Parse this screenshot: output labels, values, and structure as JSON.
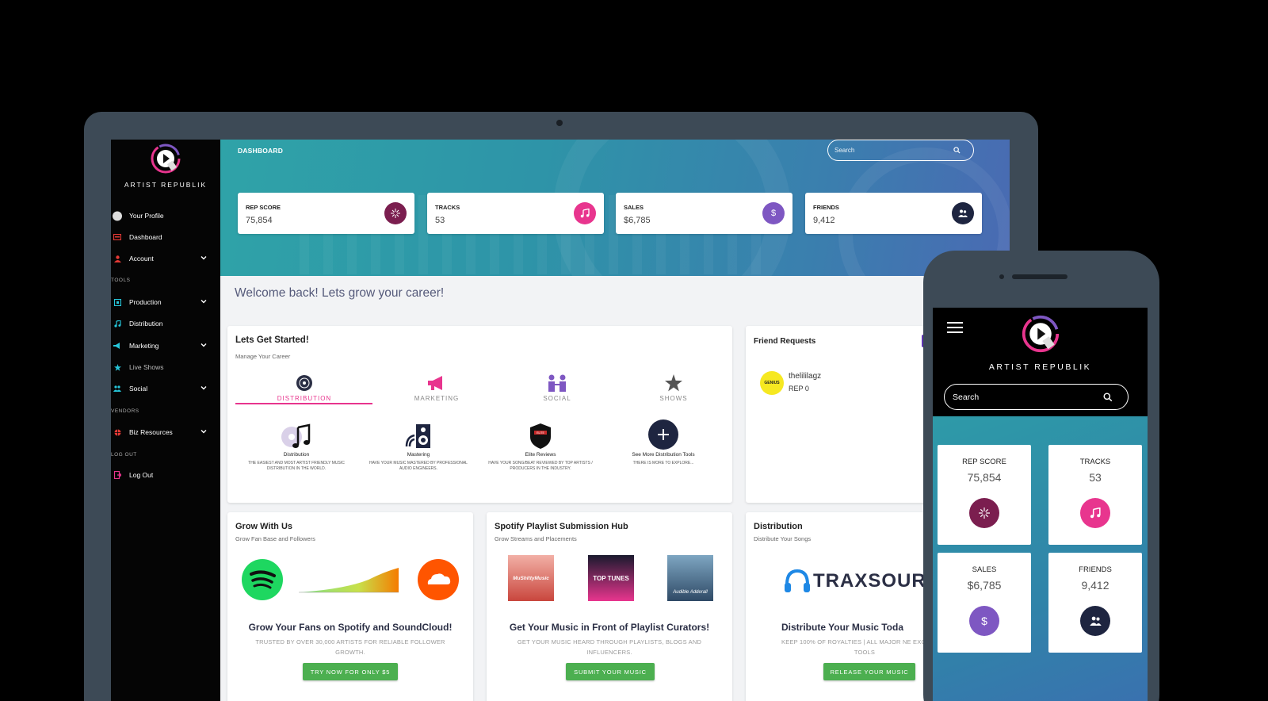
{
  "brand": {
    "name": "ARTIST REPUBLIK"
  },
  "sidebar": {
    "items": [
      {
        "label": "Your Profile",
        "icon": "avatar"
      },
      {
        "label": "Dashboard",
        "icon": "dashboard-icon"
      },
      {
        "label": "Account",
        "icon": "account-icon"
      },
      {
        "label": "Production",
        "icon": "production-icon"
      },
      {
        "label": "Distribution",
        "icon": "music-note-icon"
      },
      {
        "label": "Marketing",
        "icon": "megaphone-icon"
      },
      {
        "label": "Live Shows",
        "icon": "star-icon"
      },
      {
        "label": "Social",
        "icon": "people-icon"
      },
      {
        "label": "Biz Resources",
        "icon": "globe-icon"
      },
      {
        "label": "Log Out",
        "icon": "logout-icon"
      }
    ],
    "sections": {
      "tools": "TOOLS",
      "vendors": "VENDORS",
      "logout": "LOG OUT"
    }
  },
  "header": {
    "title": "DASHBOARD",
    "search_placeholder": "Search"
  },
  "stats": [
    {
      "label": "REP SCORE",
      "value": "75,854",
      "color": "#7b1e4f"
    },
    {
      "label": "TRACKS",
      "value": "53",
      "color": "#e8358e"
    },
    {
      "label": "SALES",
      "value": "$6,785",
      "color": "#7e57c2"
    },
    {
      "label": "FRIENDS",
      "value": "9,412",
      "color": "#1e2540"
    }
  ],
  "welcome": "Welcome back! Lets grow your career!",
  "started": {
    "title": "Lets Get Started!",
    "subtitle": "Manage Your Career",
    "tabs": [
      "DISTRIBUTION",
      "MARKETING",
      "SOCIAL",
      "SHOWS"
    ],
    "tools": [
      {
        "name": "Distribution",
        "desc": "THE EASIEST AND MOST ARTIST FRIENDLY MUSIC DISTRIBUTION IN THE WORLD."
      },
      {
        "name": "Mastering",
        "desc": "HAVE YOUR MUSIC MASTERED BY PROFESSIONAL AUDIO ENGINEERS."
      },
      {
        "name": "Elite Reviews",
        "desc": "HAVE YOUR SONG/BEAT REVIEWED BY TOP ARTISTS / PRODUCERS IN THE INDUSTRY."
      },
      {
        "name": "See More Distribution Tools",
        "desc": "THERE IS MORE TO EXPLORE..."
      }
    ]
  },
  "friend_requests": {
    "title": "Friend Requests",
    "items": [
      {
        "name": "thelililagz",
        "rep": "REP 0",
        "avatar_text": "GENIUS"
      }
    ]
  },
  "grow": {
    "title": "Grow With Us",
    "subtitle": "Grow Fan Base and Followers",
    "headline": "Grow Your Fans on Spotify and SoundCloud!",
    "text": "TRUSTED BY OVER 30,000 ARTISTS FOR RELIABLE FOLLOWER GROWTH.",
    "button": "TRY NOW FOR ONLY $5"
  },
  "playlist": {
    "title": "Spotify Playlist Submission Hub",
    "subtitle": "Grow Streams and Placements",
    "covers": [
      "MuShittyMusic",
      "TOP TUNES",
      "Audible Adderall"
    ],
    "headline": "Get Your Music in Front of Playlist Curators!",
    "text": "GET YOUR MUSIC HEARD THROUGH PLAYLISTS, BLOGS AND INFLUENCERS.",
    "button": "SUBMIT YOUR MUSIC"
  },
  "distribution": {
    "title": "Distribution",
    "subtitle": "Distribute Your Songs",
    "logo_text": "TRAXSOUR",
    "headline": "Distribute Your Music Toda",
    "text": "KEEP 100% OF ROYALTIES | ALL MAJOR NE EXCLUSIVE TOOLS",
    "button": "RELEASE YOUR MUSIC"
  },
  "phone": {
    "brand": "ARTIST REPUBLIK",
    "search_placeholder": "Search",
    "stats": [
      {
        "label": "REP SCORE",
        "value": "75,854"
      },
      {
        "label": "TRACKS",
        "value": "53"
      },
      {
        "label": "SALES",
        "value": "$6,785"
      },
      {
        "label": "FRIENDS",
        "value": "9,412"
      }
    ]
  }
}
